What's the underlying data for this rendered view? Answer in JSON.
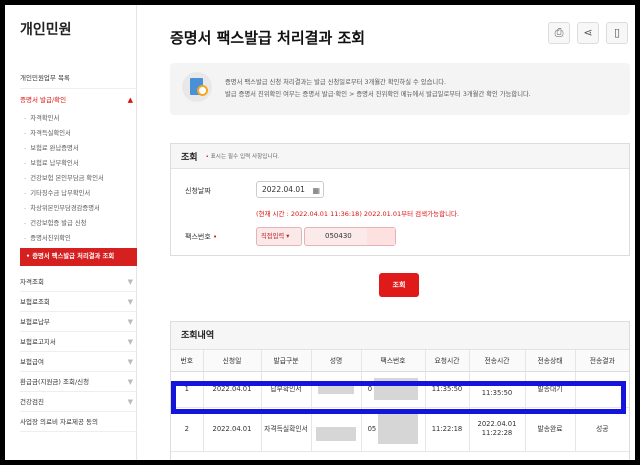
{
  "sidebar": {
    "title": "개인민원",
    "top_link": "개인민원업무 목록",
    "open_section": "증명서 발급/확인",
    "open_arrow": "▲",
    "sub_items": [
      "자격확인서",
      "자격득실확인서",
      "보험료 완납증명서",
      "보험료 납부확인서",
      "건강보험 본인부담금 확인서",
      "기타징수금 납부확인서",
      "차상위본인부담경감증명서",
      "건강보험증 발급 신청",
      "증명서진위확인"
    ],
    "active_item": "증명서 팩스발급 처리결과 조회",
    "sections": [
      "자격조회",
      "보험료조회",
      "보험료납부",
      "보험료고지서",
      "보험급여",
      "환급금(지원금) 조회/신청",
      "건강검진",
      "사업장 의료비 자료제공 동의"
    ],
    "chevron": "▼"
  },
  "header": {
    "title": "증명서 팩스발급 처리결과 조회",
    "icons": [
      "print-icon",
      "share-icon",
      "bookmark-icon"
    ]
  },
  "notice": {
    "line1": "증명서 팩스발급 신청 처리결과는 발급 신청일로부터 3개월간 확인하실 수 있습니다.",
    "line2": "발급 증명서 진위확인 여부는 증명서 발급·확인 > 증명서 진위확인 메뉴에서 발급일로부터 3개월간 확인 가능합니다."
  },
  "search": {
    "heading": "조회",
    "required_note": "표시는 필수 입력 사항입니다.",
    "date_label": "신청날짜",
    "date_value": "2022.04.01",
    "hint": "(현재 시간 : 2022.04.01 11:36:18) 2022.01.01부터 검색가능합니다.",
    "fax_label": "팩스번호",
    "fax_select": "직접입력",
    "fax_value": "050430",
    "button": "조회"
  },
  "results": {
    "heading": "조회내역",
    "columns": [
      "번호",
      "신청일",
      "발급구분",
      "성명",
      "팩스번호",
      "요청시간",
      "전송시간",
      "전송상태",
      "전송결과"
    ],
    "rows": [
      {
        "no": "1",
        "date": "2022.04.01",
        "type": "납부확인서",
        "name": "",
        "fax": "0",
        "req": "11:35:50",
        "sent": "2022.04.01 11:35:50",
        "status": "발송대기",
        "result": ""
      },
      {
        "no": "2",
        "date": "2022.04.01",
        "type": "자격득실확인서",
        "name": "",
        "fax": "05",
        "req": "11:22:18",
        "sent": "2022.04.01 11:22:28",
        "status": "발송완료",
        "result": "성공"
      }
    ]
  },
  "colors": {
    "accent": "#e01919",
    "highlight": "#1414dc"
  }
}
